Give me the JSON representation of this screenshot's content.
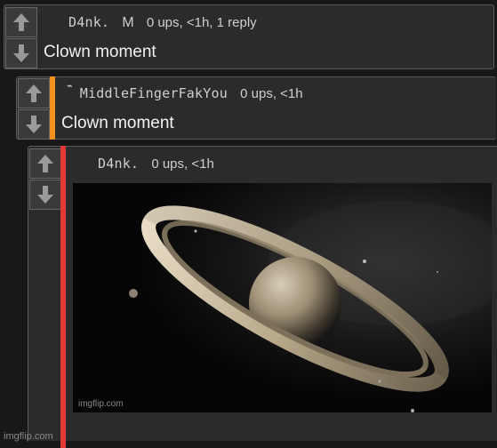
{
  "comments": [
    {
      "username": "D4nk.",
      "badge": "M",
      "meta": "0 ups, <1h, 1 reply",
      "text": "Clown moment"
    },
    {
      "flair": "⌁",
      "username": "MiddleFingerFakYou",
      "meta": "0 ups, <1h",
      "text": "Clown moment",
      "bar_color": "#f0921e"
    },
    {
      "username": "D4nk.",
      "meta": "0 ups, <1h",
      "bar_color": "#e53935",
      "image_watermark": "imgflip.com"
    }
  ],
  "footer_watermark": "imgflip.com",
  "colors": {
    "background": "#181818",
    "card": "#2b2b2b",
    "reply_bar_orange": "#f0921e",
    "reply_bar_red": "#e53935"
  }
}
